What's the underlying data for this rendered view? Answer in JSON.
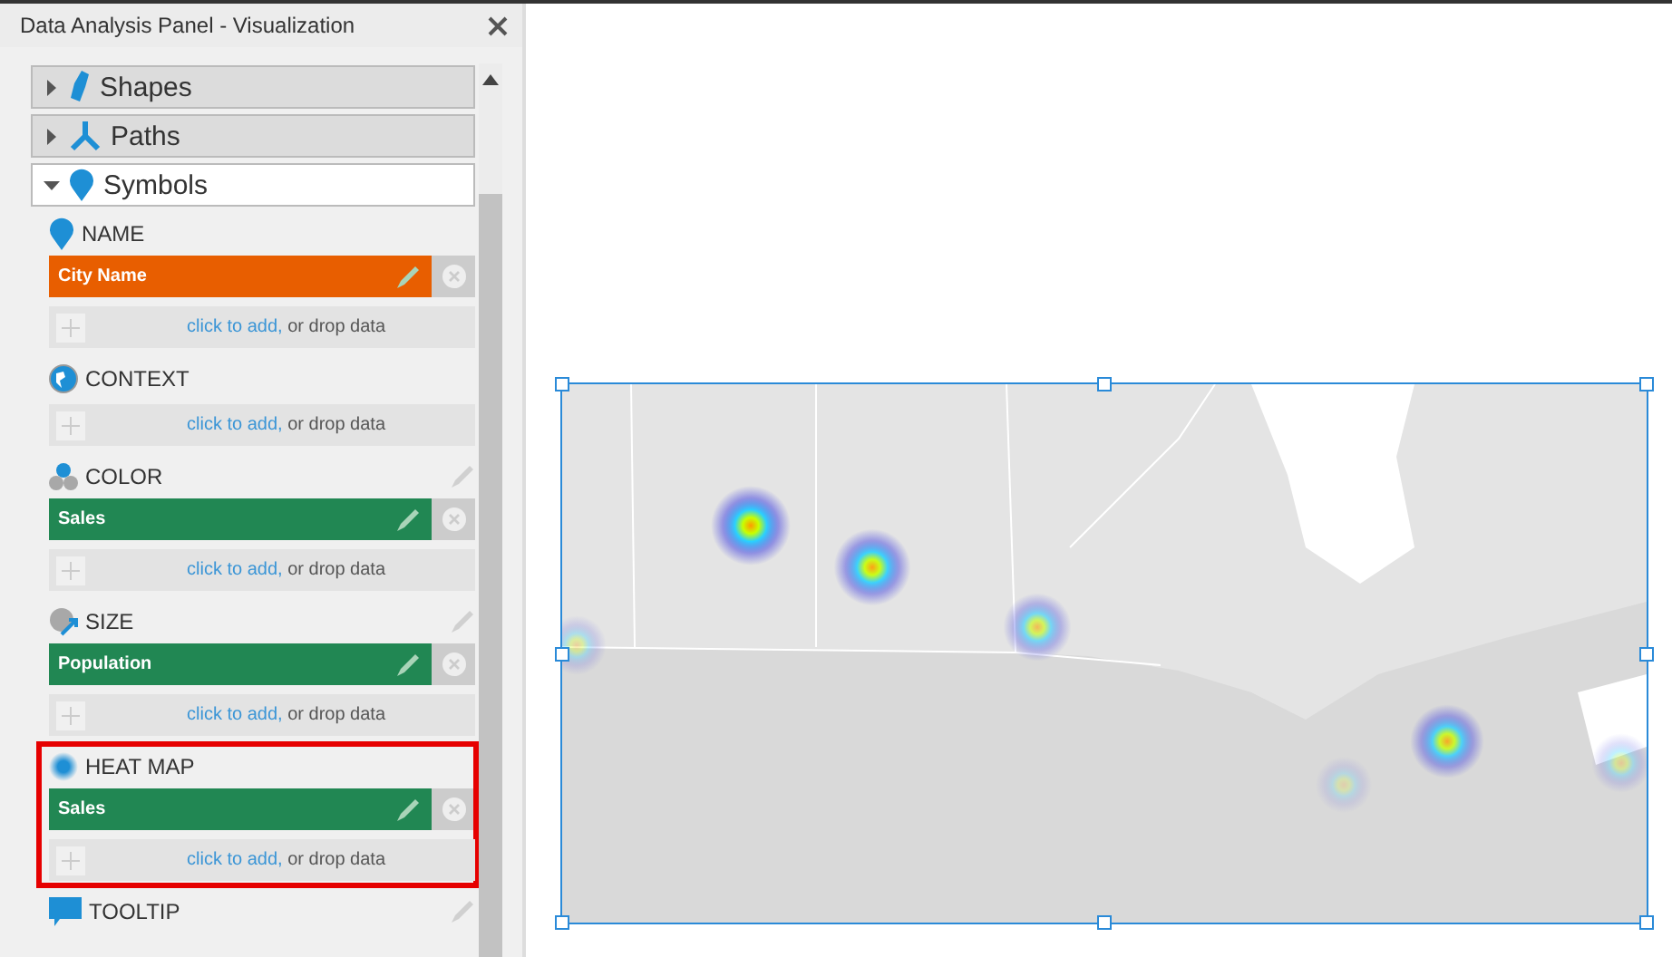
{
  "panel": {
    "title": "Data Analysis Panel - Visualization"
  },
  "sections": [
    {
      "kind": "shapes",
      "label": "Shapes",
      "expanded": false
    },
    {
      "kind": "paths",
      "label": "Paths",
      "expanded": false
    },
    {
      "kind": "symbols",
      "label": "Symbols",
      "expanded": true
    }
  ],
  "fields": [
    {
      "kind": "name",
      "label": "NAME",
      "editable": false,
      "highlighted": false,
      "items": [
        {
          "label": "City Name",
          "color": "#e85e00"
        }
      ],
      "add_link": "click to add,",
      "add_text": " or drop data"
    },
    {
      "kind": "context",
      "label": "CONTEXT",
      "editable": false,
      "highlighted": false,
      "add_link": "click to add,",
      "add_text": " or drop data"
    },
    {
      "kind": "color",
      "label": "COLOR",
      "editable": true,
      "highlighted": false,
      "items": [
        {
          "label": "Sales",
          "color": "#218753"
        }
      ],
      "add_link": "click to add,",
      "add_text": " or drop data"
    },
    {
      "kind": "size",
      "label": "SIZE",
      "editable": true,
      "highlighted": false,
      "items": [
        {
          "label": "Population",
          "color": "#218753"
        }
      ],
      "add_link": "click to add,",
      "add_text": " or drop data"
    },
    {
      "kind": "heat_map",
      "label": "HEAT MAP",
      "editable": false,
      "highlighted": true,
      "items": [
        {
          "label": "Sales",
          "color": "#218753"
        }
      ],
      "add_link": "click to add,",
      "add_text": " or drop data"
    },
    {
      "kind": "tooltip",
      "label": "TOOLTIP",
      "editable": true,
      "highlighted": false
    }
  ]
}
